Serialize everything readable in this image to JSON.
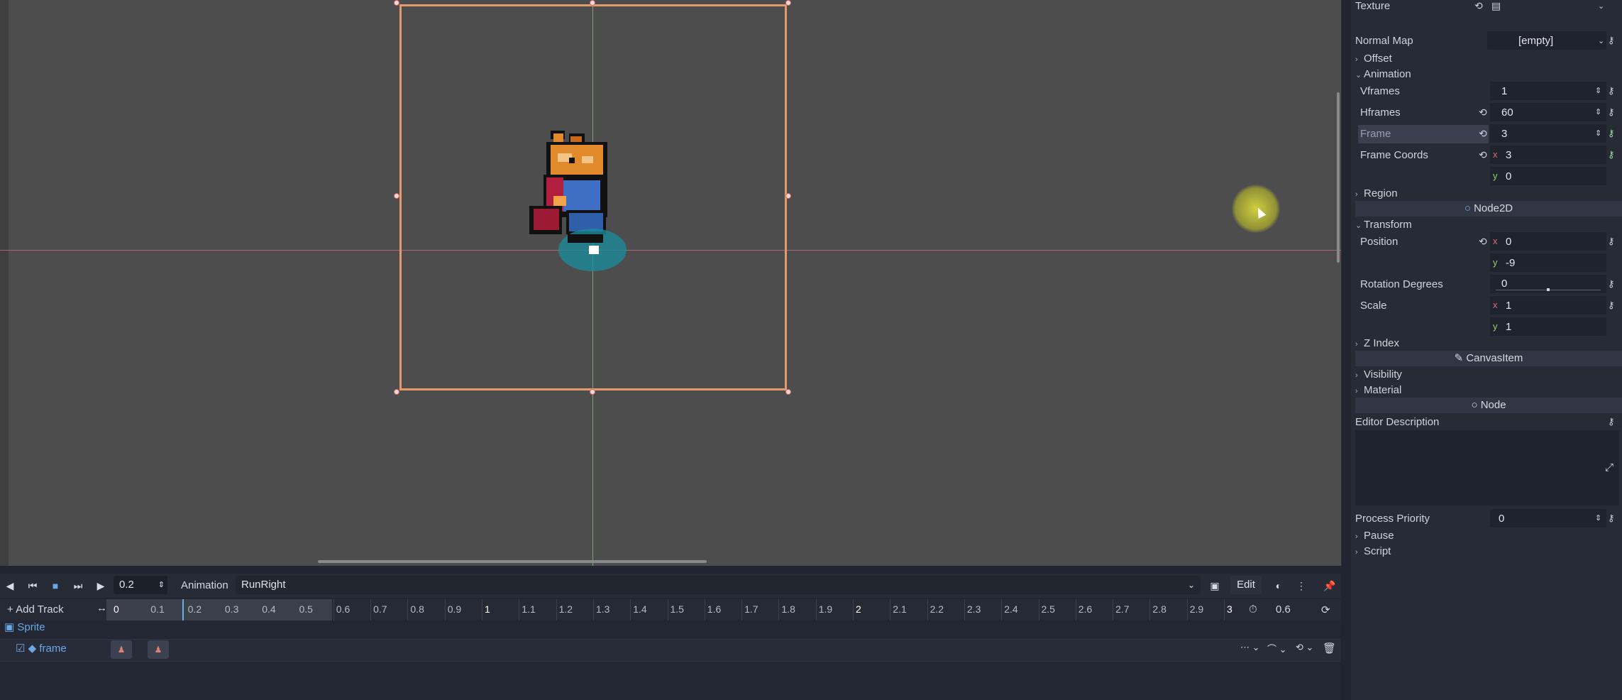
{
  "inspector": {
    "texture_label": "Texture",
    "normal_map_label": "Normal Map",
    "normal_map_value": "[empty]",
    "offset": "Offset",
    "animation": "Animation",
    "vframes_label": "Vframes",
    "vframes_value": "1",
    "hframes_label": "Hframes",
    "hframes_value": "60",
    "frame_label": "Frame",
    "frame_value": "3",
    "frame_coords_label": "Frame Coords",
    "frame_coords_x": "3",
    "frame_coords_y": "0",
    "region": "Region",
    "node2d_band": "Node2D",
    "transform": "Transform",
    "position_label": "Position",
    "position_x": "0",
    "position_y": "-9",
    "rotation_label": "Rotation Degrees",
    "rotation_value": "0",
    "scale_label": "Scale",
    "scale_x": "1",
    "scale_y": "1",
    "z_index": "Z Index",
    "canvasitem_band": "CanvasItem",
    "visibility": "Visibility",
    "material": "Material",
    "node_band": "Node",
    "editor_description": "Editor Description",
    "process_priority_label": "Process Priority",
    "process_priority_value": "0",
    "pause": "Pause",
    "script": "Script",
    "x_axis": "x",
    "y_axis": "y"
  },
  "animation_panel": {
    "time_value": "0.2",
    "animation_label": "Animation",
    "animation_name": "RunRight",
    "edit_label": "Edit",
    "add_track": "Add Track",
    "length_value": "0.6",
    "track_group": "Sprite",
    "track_name": "frame",
    "ticks": [
      "0",
      "0.1",
      "0.2",
      "0.3",
      "0.4",
      "0.5",
      "0.6",
      "0.7",
      "0.8",
      "0.9",
      "1",
      "1.1",
      "1.2",
      "1.3",
      "1.4",
      "1.5",
      "1.6",
      "1.7",
      "1.8",
      "1.9",
      "2",
      "2.1",
      "2.2",
      "2.3",
      "2.4",
      "2.5",
      "2.6",
      "2.7",
      "2.8",
      "2.9",
      "3"
    ]
  },
  "colors": {
    "selection_box": "#e59a6c",
    "x_axis_line": "#c86a7e",
    "y_axis_line": "#7fbf7f",
    "playhead": "#6aa8e6",
    "track_label": "#6aa8e6"
  },
  "icons": [
    "play-backward-icon",
    "step-back-icon",
    "stop-icon",
    "step-forward-icon",
    "play-icon",
    "add-icon",
    "loop-icon",
    "pin-icon",
    "key-icon",
    "revert-icon",
    "trash-icon",
    "menu-icon",
    "onion-skin-icon",
    "expand-icon"
  ]
}
